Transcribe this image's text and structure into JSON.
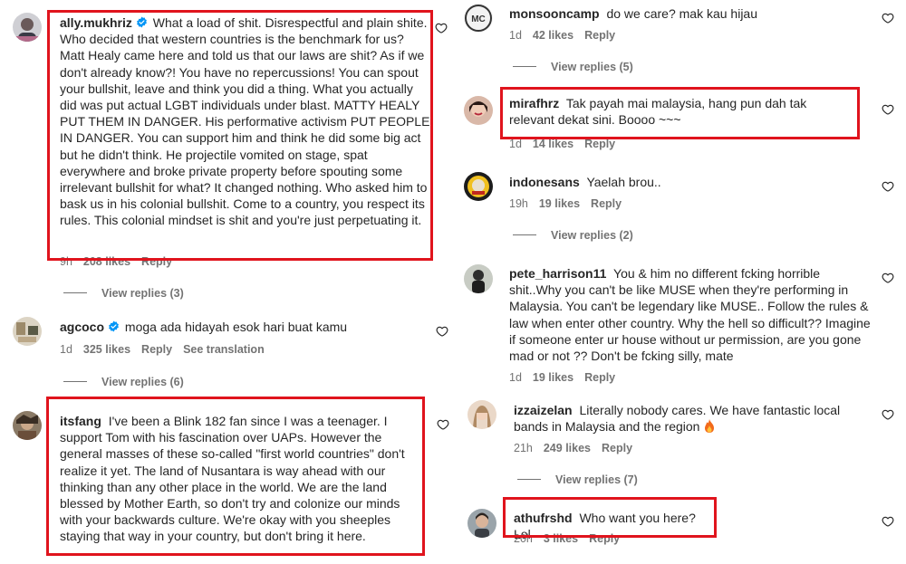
{
  "comments": {
    "ally": {
      "username": "ally.mukhriz",
      "text": "What a load of shit. Disrespectful and plain shite. Who decided that western countries is the benchmark for us? Matt Healy came here and told us that our laws are shit? As if we don't already know?! You have no repercussions! You can spout your bullshit, leave and think you did a thing. What you actually did was put actual LGBT individuals under blast. MATTY HEALY PUT THEM IN DANGER. His performative activism PUT PEOPLE IN DANGER. You can support him and think he did some big act but he didn't think. He projectile vomited on stage, spat everywhere and broke private property before spouting some irrelevant bullshit for what? It changed nothing. Who asked him to bask us in his colonial bullshit. Come to a country, you respect its rules. This colonial mindset is shit and you're just perpetuating it.",
      "time": "9h",
      "likes": "208 likes",
      "reply": "Reply",
      "view_replies": "View replies (3)"
    },
    "agcoco": {
      "username": "agcoco",
      "text": "moga ada hidayah esok hari buat kamu",
      "time": "1d",
      "likes": "325 likes",
      "reply": "Reply",
      "translate": "See translation",
      "view_replies": "View replies (6)"
    },
    "itsfang": {
      "username": "itsfang",
      "text": "I've been a Blink 182 fan since I was a teenager. I support Tom with his fascination over UAPs. However the general masses of these so-called \"first world countries\" don't realize it yet. The land of Nusantara is way ahead with our thinking than any other place in the world. We are the land blessed by Mother Earth, so don't try and colonize our minds with your backwards culture. We're okay with you sheeples staying that way in your country, but don't bring it here."
    },
    "monsooncamp": {
      "username": "monsooncamp",
      "text": "do we care? mak kau hijau",
      "time": "1d",
      "likes": "42 likes",
      "reply": "Reply",
      "view_replies": "View replies (5)"
    },
    "mirafhrz": {
      "username": "mirafhrz",
      "text": "Tak payah mai malaysia, hang pun dah tak relevant dekat sini. Boooo ~~~",
      "time": "1d",
      "likes": "14 likes",
      "reply": "Reply"
    },
    "indonesans": {
      "username": "indonesans",
      "text": "Yaelah brou..",
      "time": "19h",
      "likes": "19 likes",
      "reply": "Reply",
      "view_replies": "View replies (2)"
    },
    "pete": {
      "username": "pete_harrison11",
      "text": "You & him no different fcking horrible shit..Why you can't be like MUSE when they're performing in Malaysia. You can't be legendary like MUSE.. Follow the rules & law when enter other country. Why the hell so difficult?? Imagine if someone enter ur house without ur permission, are you gone mad or not ?? Don't be fcking silly, mate",
      "time": "1d",
      "likes": "19 likes",
      "reply": "Reply"
    },
    "izzaizelan": {
      "username": "izzaizelan",
      "text": "Literally nobody cares. We have fantastic local bands in Malaysia and the region",
      "time": "21h",
      "likes": "249 likes",
      "reply": "Reply",
      "view_replies": "View replies (7)"
    },
    "athufrshd": {
      "username": "athufrshd",
      "text": "Who want you here? Lol",
      "time": "20h",
      "likes": "3 likes",
      "reply": "Reply"
    }
  },
  "icons": {
    "heart": "heart-outline-icon",
    "verified": "verified-badge-icon",
    "fire": "fire-emoji-icon"
  },
  "colors": {
    "highlight": "#e0141d",
    "verified": "#0095f6",
    "meta_text": "#737373",
    "body_text": "#262626"
  }
}
